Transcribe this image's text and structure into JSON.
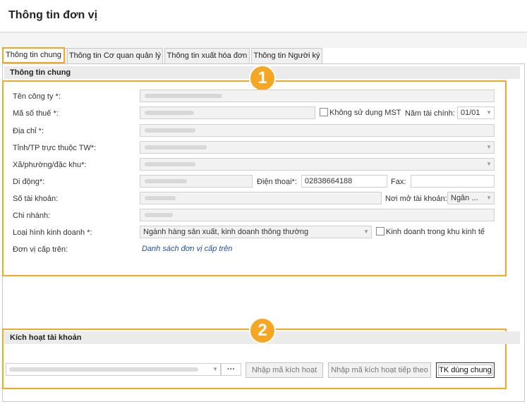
{
  "window": {
    "title": "Thông tin đơn vị"
  },
  "tabs": [
    {
      "label": "Thông tin chung",
      "active": true
    },
    {
      "label": "Thông tin Cơ quan quản lý",
      "active": false
    },
    {
      "label": "Thông tin xuất hóa đơn",
      "active": false
    },
    {
      "label": "Thông tin Người ký",
      "active": false
    }
  ],
  "general": {
    "header": "Thông tin chung",
    "badge": "1",
    "company_name_label": "Tên công ty *:",
    "tax_code_label": "Mã số thuế *:",
    "no_tax_code_label": "Không sử dụng MST",
    "fiscal_year_label": "Năm tài chính:",
    "fiscal_year_value": "01/01",
    "address_label": "Địa chỉ *:",
    "province_label": "Tỉnh/TP trực thuộc TW*:",
    "ward_label": "Xã/phường/đặc khu*:",
    "mobile_label": "Di động*:",
    "phone_label": "Điện thoại*:",
    "phone_value": "02838664188",
    "fax_label": "Fax:",
    "account_no_label": "Số tài khoản:",
    "bank_label": "Nơi mở tài khoản:",
    "bank_value": "Ngân ...",
    "branch_label": "Chi nhánh:",
    "business_type_label": "Loại hình kinh doanh *:",
    "business_type_value": "Ngành hàng sản xuất, kinh doanh thông thường",
    "economic_zone_label": "Kinh doanh trong khu kinh tế",
    "parent_unit_label": "Đơn vị cấp trên:",
    "parent_unit_link": "Danh sách đơn vị cấp trên"
  },
  "activation": {
    "header": "Kích hoạt tài khoản",
    "badge": "2",
    "more_button": "···",
    "enter_code_button": "Nhập mã kích hoạt",
    "enter_next_code_button": "Nhập mã kích hoạt tiếp theo",
    "shared_account_button": "TK dùng chung"
  }
}
